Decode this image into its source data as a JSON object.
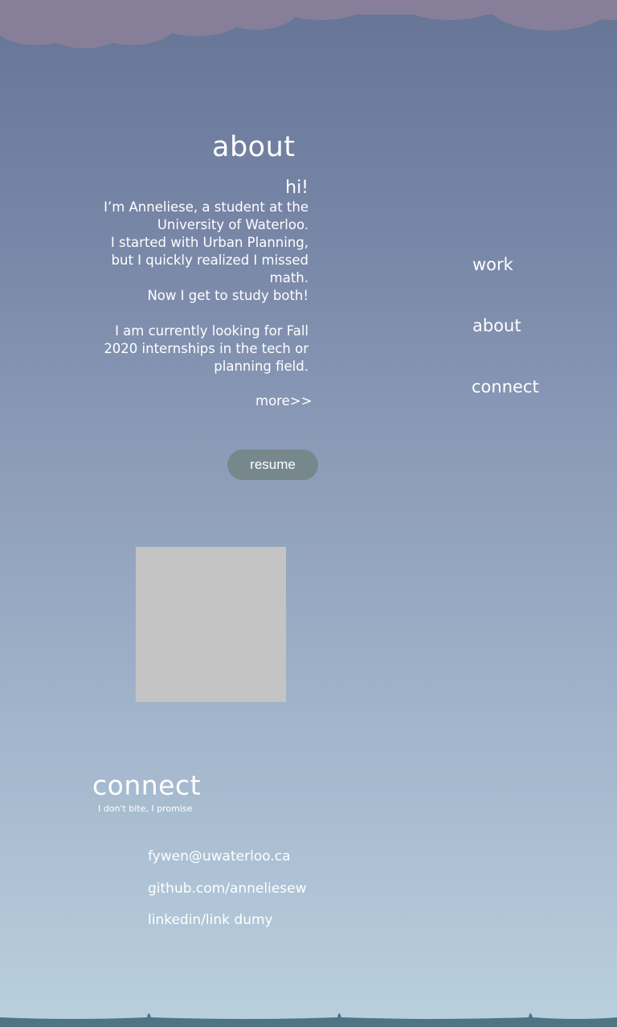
{
  "about": {
    "title": "about",
    "greeting": "hi!",
    "lines": [
      "I’m Anneliese, a student at the",
      "University of Waterloo.",
      "I started with Urban Planning,",
      "but I quickly realized I missed",
      "math.",
      "Now I get to study both!",
      "I am currently looking for Fall",
      "2020 internships in the tech or",
      "planning field."
    ],
    "more": "more>>",
    "resume_label": "resume"
  },
  "nav": {
    "work": "work",
    "about": "about",
    "connect": "connect"
  },
  "connect": {
    "title": "connect",
    "subtitle": "I don't bite,  I promise",
    "email": "fywen@uwaterloo.ca",
    "github": "github.com/anneliesew",
    "linkedin": "linkedin/link dumy"
  },
  "colors": {
    "sky_top": "#667596",
    "sky_bottom": "#b9d0de",
    "cloud": "#877f99",
    "resume_button": "#76888c",
    "photo_placeholder": "#c4c4c4",
    "wave": "#4f7585"
  }
}
